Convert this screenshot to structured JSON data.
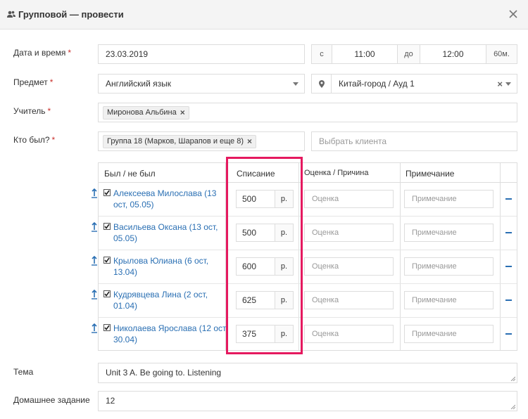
{
  "dialog": {
    "title": "Групповой — провести"
  },
  "labels": {
    "datetime": "Дата и время",
    "subject": "Предмет",
    "teacher": "Учитель",
    "attended": "Кто был?",
    "topic": "Тема",
    "homework": "Домашнее задание",
    "required_mark": "*"
  },
  "datetime": {
    "date": "23.03.2019",
    "from_label": "с",
    "from": "11:00",
    "to_label": "до",
    "to": "12:00",
    "duration": "60м."
  },
  "subject": {
    "value": "Английский язык"
  },
  "location": {
    "value": "Китай-город / Ауд 1"
  },
  "teacher": {
    "tag": "Миронова Альбина"
  },
  "attendees": {
    "tag": "Группа 18 (Марков, Шарапов и еще 8)",
    "client_placeholder": "Выбрать клиента"
  },
  "table": {
    "headers": [
      "Был / не был",
      "Списание",
      "Оценка / Причина",
      "Примечание"
    ],
    "rows": [
      {
        "name": "Алексеева Милослава (13 ост, 05.05)",
        "amount": "500",
        "unit": "р.",
        "grade_placeholder": "Оценка",
        "note_placeholder": "Примечание",
        "checked": true
      },
      {
        "name": "Васильева Оксана (13 ост, 05.05)",
        "amount": "500",
        "unit": "р.",
        "grade_placeholder": "Оценка",
        "note_placeholder": "Примечание",
        "checked": true
      },
      {
        "name": "Крылова Юлиана (6 ост, 13.04)",
        "amount": "600",
        "unit": "р.",
        "grade_placeholder": "Оценка",
        "note_placeholder": "Примечание",
        "checked": true
      },
      {
        "name": "Кудрявцева Лина (2 ост, 01.04)",
        "amount": "625",
        "unit": "р.",
        "grade_placeholder": "Оценка",
        "note_placeholder": "Примечание",
        "checked": true
      },
      {
        "name": "Николаева Ярослава (12 ост, 30.04)",
        "amount": "375",
        "unit": "р.",
        "grade_placeholder": "Оценка",
        "note_placeholder": "Примечание",
        "checked": true
      }
    ]
  },
  "topic": {
    "value": "Unit 3 A. Be going to. Listening"
  },
  "homework": {
    "value": "12"
  },
  "colors": {
    "accent": "#2a6fb3",
    "highlight": "#e5195f",
    "required": "#c9302c"
  }
}
